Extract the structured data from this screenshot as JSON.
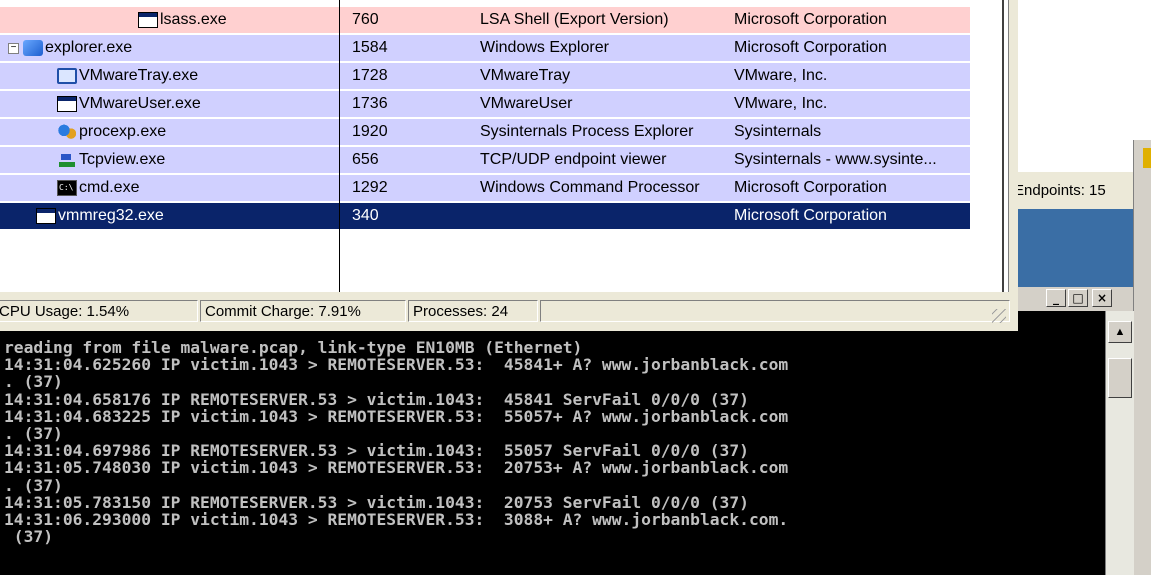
{
  "process_list": {
    "rows": [
      {
        "name": "lsass.exe",
        "pid": "760",
        "description": "LSA Shell (Export Version)",
        "company": "Microsoft Corporation",
        "icon": "window-icon",
        "color": "#ffd0d0"
      },
      {
        "name": "explorer.exe",
        "pid": "1584",
        "description": "Windows Explorer",
        "company": "Microsoft Corporation",
        "icon": "explorer-icon",
        "color": "#d0d0ff"
      },
      {
        "name": "VMwareTray.exe",
        "pid": "1728",
        "description": "VMwareTray",
        "company": "VMware, Inc.",
        "icon": "vmware-tray-icon",
        "color": "#d0d0ff"
      },
      {
        "name": "VMwareUser.exe",
        "pid": "1736",
        "description": "VMwareUser",
        "company": "VMware, Inc.",
        "icon": "window-icon",
        "color": "#d0d0ff"
      },
      {
        "name": "procexp.exe",
        "pid": "1920",
        "description": "Sysinternals Process Explorer",
        "company": "Sysinternals",
        "icon": "procexp-icon",
        "color": "#d0d0ff"
      },
      {
        "name": "Tcpview.exe",
        "pid": "656",
        "description": "TCP/UDP endpoint viewer",
        "company": "Sysinternals - www.sysinte...",
        "icon": "tcpview-icon",
        "color": "#d0d0ff"
      },
      {
        "name": "cmd.exe",
        "pid": "1292",
        "description": "Windows Command Processor",
        "company": "Microsoft Corporation",
        "icon": "cmd-icon",
        "color": "#d0d0ff"
      },
      {
        "name": "vmmreg32.exe",
        "pid": "340",
        "description": "",
        "company": "Microsoft Corporation",
        "icon": "window-icon",
        "color": "#0a246a",
        "selected": true
      }
    ],
    "collapse_glyph": "−"
  },
  "status_bar": {
    "cpu": "CPU Usage: 1.54%",
    "commit": "Commit Charge: 7.91%",
    "processes": "Processes: 24"
  },
  "tcpview": {
    "endpoints": "Endpoints: 15"
  },
  "console": {
    "buttons": {
      "minimize": "_",
      "maximize": "□",
      "close": "×"
    },
    "lines": [
      "reading from file malware.pcap, link-type EN10MB (Ethernet)",
      "14:31:04.625260 IP victim.1043 > REMOTESERVER.53:  45841+ A? www.jorbanblack.com",
      ". (37)",
      "14:31:04.658176 IP REMOTESERVER.53 > victim.1043:  45841 ServFail 0/0/0 (37)",
      "14:31:04.683225 IP victim.1043 > REMOTESERVER.53:  55057+ A? www.jorbanblack.com",
      ". (37)",
      "14:31:04.697986 IP REMOTESERVER.53 > victim.1043:  55057 ServFail 0/0/0 (37)",
      "14:31:05.748030 IP victim.1043 > REMOTESERVER.53:  20753+ A? www.jorbanblack.com",
      ". (37)",
      "14:31:05.783150 IP REMOTESERVER.53 > victim.1043:  20753 ServFail 0/0/0 (37)",
      "14:31:06.293000 IP victim.1043 > REMOTESERVER.53:  3088+ A? www.jorbanblack.com.",
      " (37)"
    ]
  }
}
